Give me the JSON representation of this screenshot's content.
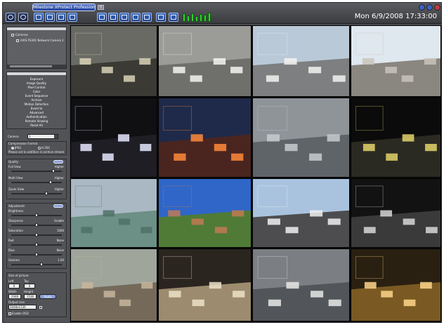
{
  "titlebar": {
    "title": "Milestone XProtect Professional",
    "datetime": "Mon 6/9/2008 17:33:00"
  },
  "toolbar": {
    "buttons": [
      {
        "name": "ptz-button"
      },
      {
        "name": "playback-button"
      },
      {
        "name": "layout-1x1-button"
      },
      {
        "name": "layout-2x2-button"
      },
      {
        "name": "layout-3x3-button"
      },
      {
        "name": "layout-4x4-button"
      },
      {
        "name": "layout-1-7-button"
      },
      {
        "name": "layout-1-12-button"
      },
      {
        "name": "layout-2-8-button"
      },
      {
        "name": "layout-5x5-button"
      },
      {
        "name": "layout-custom-button"
      },
      {
        "name": "fullscreen-button"
      },
      {
        "name": "setup-button"
      }
    ],
    "meter_levels": [
      0.9,
      0.7,
      0.95,
      0.6,
      0.85,
      0.75,
      1.0
    ]
  },
  "tree": {
    "root": "Cameras",
    "child": "AXIS P3301 Network Camera 1"
  },
  "menu": {
    "items": [
      "Exposure",
      "Image Quality",
      "Pixel Control",
      "Color",
      "Event Sequence",
      "Archive",
      "Motion Detection",
      "Event to",
      "Advanced",
      "Authentication",
      "Remote Viewing",
      "Reset All"
    ]
  },
  "settings": {
    "camera_label": "Camera",
    "camera_value": "1",
    "compression_label": "Compression Format",
    "compression_options": [
      "JPEG",
      "H.264"
    ],
    "compression_selected": "H.264",
    "compression_note": "Please set to addition in archive stream",
    "quality_title": "Quality",
    "quality_rows": [
      {
        "label": "Full View",
        "right": "Higher",
        "level": 0.85
      },
      {
        "label": "Multi View",
        "right": "Higher",
        "level": 0.8
      },
      {
        "label": "Zoom View",
        "right": "Higher",
        "level": 0.7
      }
    ],
    "adjustment_title": "Adjustment",
    "adjustment_rows": [
      {
        "label": "Brightness",
        "right": "",
        "level": 0.5
      },
      {
        "label": "Sharpness",
        "right": "Enable",
        "level": 0.5
      },
      {
        "label": "Saturation",
        "right": "1000",
        "level": 0.5
      },
      {
        "label": "Red",
        "right": "None",
        "level": 0.5
      },
      {
        "label": "Blue",
        "right": "None",
        "level": 0.5
      },
      {
        "label": "Gamma",
        "right": "1.00",
        "level": 0.6
      }
    ],
    "picture_title": "Size of picture",
    "left_label": "Left",
    "left_value": "0",
    "top_label": "Top",
    "top_value": "0",
    "width_label": "Width",
    "width_value": "2048",
    "height_label": "Height",
    "height_value": "1536",
    "apply_label": "Apply",
    "output_label": "Output size",
    "output_value": "2048x1536",
    "footer_checkbox": "Enable OSD"
  },
  "cameras": [
    {
      "name": "cam-workshop",
      "sky": "#6a6a64",
      "ground": "#3b3a34",
      "accent": "#d9d2b8"
    },
    {
      "name": "cam-parking-top",
      "sky": "#9b9b97",
      "ground": "#6f6f6b",
      "accent": "#f4f4f2"
    },
    {
      "name": "cam-truck-lot",
      "sky": "#b9c9d8",
      "ground": "#7d7f80",
      "accent": "#f2f2f0"
    },
    {
      "name": "cam-street-palms",
      "sky": "#dfe7ef",
      "ground": "#8a8680",
      "accent": "#c9c4bb"
    },
    {
      "name": "cam-night-garage",
      "sky": "#101013",
      "ground": "#1e1e24",
      "accent": "#e8e8ff"
    },
    {
      "name": "cam-night-building",
      "sky": "#1f2a4a",
      "ground": "#4a2520",
      "accent": "#ff8a3a"
    },
    {
      "name": "cam-aerial-street",
      "sky": "#8f9499",
      "ground": "#5f6469",
      "accent": "#c8cbcf"
    },
    {
      "name": "cam-night-plaza",
      "sky": "#0b0b0b",
      "ground": "#2b2a22",
      "accent": "#e3d46a"
    },
    {
      "name": "cam-building-day",
      "sky": "#a9b8c2",
      "ground": "#6c8f86",
      "accent": "#4f7166"
    },
    {
      "name": "cam-fisheye-campus",
      "sky": "#2f66c8",
      "ground": "#4f7b37",
      "accent": "#bf7a52"
    },
    {
      "name": "cam-highway",
      "sky": "#a9c3df",
      "ground": "#4d4d4f",
      "accent": "#f0f0ee"
    },
    {
      "name": "cam-dark-warehouse",
      "sky": "#121212",
      "ground": "#3a3a3a",
      "accent": "#d8d8d8"
    },
    {
      "name": "cam-rooftop",
      "sky": "#9fa59b",
      "ground": "#756a5a",
      "accent": "#c7b59c"
    },
    {
      "name": "cam-fisheye-lobby",
      "sky": "#2b2520",
      "ground": "#9c8b6e",
      "accent": "#ece2c8"
    },
    {
      "name": "cam-traffic-aerial",
      "sky": "#7b7f83",
      "ground": "#52565a",
      "accent": "#e8e8e6"
    },
    {
      "name": "cam-warehouse-lit",
      "sky": "#2a2011",
      "ground": "#7a5a22",
      "accent": "#ffd58a"
    }
  ]
}
